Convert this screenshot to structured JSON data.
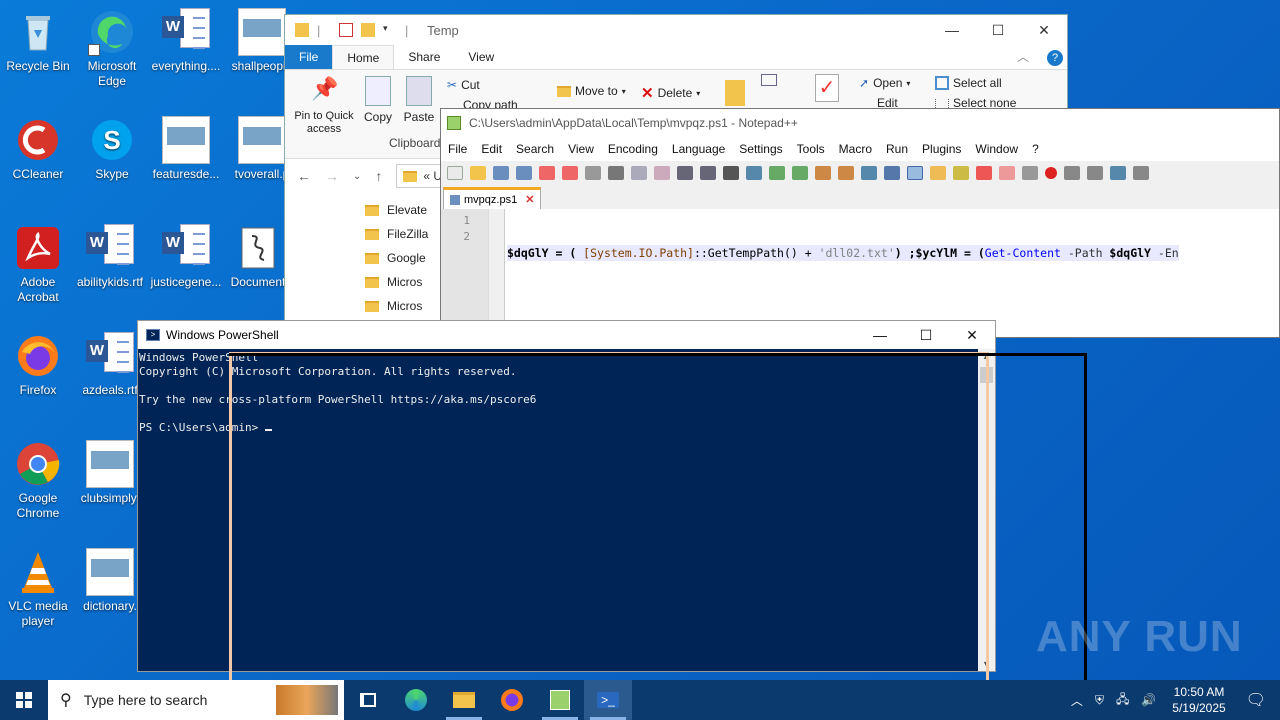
{
  "desktop": {
    "icons": [
      {
        "label": "Recycle Bin"
      },
      {
        "label": "Microsoft Edge"
      },
      {
        "label": "everything...."
      },
      {
        "label": "shallpeople"
      },
      {
        "label": "CCleaner"
      },
      {
        "label": "Skype"
      },
      {
        "label": "featuresde..."
      },
      {
        "label": "tvoverall.p"
      },
      {
        "label": "Adobe Acrobat"
      },
      {
        "label": "abilitykids.rtf"
      },
      {
        "label": "justicegene..."
      },
      {
        "label": "Document"
      },
      {
        "label": "Firefox"
      },
      {
        "label": "azdeals.rtf"
      },
      {
        "label": "Google Chrome"
      },
      {
        "label": "clubsimply."
      },
      {
        "label": "VLC media player"
      },
      {
        "label": "dictionary."
      }
    ]
  },
  "explorer": {
    "title": "Temp",
    "tabs": [
      "File",
      "Home",
      "Share",
      "View"
    ],
    "ribbon": {
      "pin": "Pin to Quick access",
      "copy": "Copy",
      "paste": "Paste",
      "cut": "Cut",
      "copy_path": "Copy path",
      "move_to": "Move to",
      "delete": "Delete",
      "open": "Open",
      "edit": "Edit",
      "select_all": "Select all",
      "select_none": "Select none",
      "group_clipboard": "Clipboard"
    },
    "breadcrumb": "«  U",
    "folders": [
      "Elevate",
      "FileZilla",
      "Google",
      "Micros",
      "Micros"
    ]
  },
  "notepadpp": {
    "title": "C:\\Users\\admin\\AppData\\Local\\Temp\\mvpqz.ps1 - Notepad++",
    "menu": [
      "File",
      "Edit",
      "Search",
      "View",
      "Encoding",
      "Language",
      "Settings",
      "Tools",
      "Macro",
      "Run",
      "Plugins",
      "Window",
      "?"
    ],
    "tab": "mvpqz.ps1",
    "line_numbers": [
      "1",
      "2"
    ],
    "code": {
      "var1": "$dqGlY",
      "eq1": " = ( ",
      "type": "[System.IO.Path]",
      "method": "::GetTempPath() + ",
      "str": "'dll02.txt'",
      "close": ") ;",
      "var2": "$ycYlM",
      "eq2": " = (",
      "cmd": "Get-Content",
      "param": " -Path ",
      "var3": "$dqGlY",
      "tail": " -En"
    }
  },
  "powershell": {
    "title": "Windows PowerShell",
    "lines": [
      "Windows PowerShell",
      "Copyright (C) Microsoft Corporation. All rights reserved.",
      "",
      "Try the new cross-platform PowerShell https://aka.ms/pscore6",
      "",
      "PS C:\\Users\\admin> "
    ]
  },
  "taskbar": {
    "search_placeholder": "Type here to search",
    "time": "10:50 AM",
    "date": "5/19/2025"
  },
  "watermark": "ANY RUN",
  "colors": {
    "ps_background": "#012456",
    "desktop": "#0a68c9",
    "taskbar": "#0b3a6e"
  }
}
